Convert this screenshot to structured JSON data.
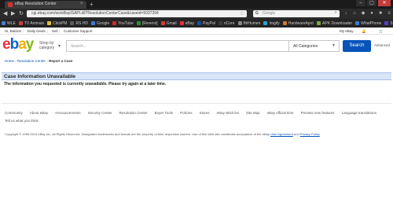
{
  "browser": {
    "tab_title": "eBay Resolution Center",
    "close_glyph": "×",
    "new_tab_glyph": "+",
    "window_controls": [
      "–",
      "▢",
      "✕"
    ],
    "url": "cgi.ebay.com/ws/eBayISAPI.dll?ResolutionCenterCase&caseid=5037394",
    "search_engine_glyph": "G",
    "search_placeholder": "Google",
    "bookmarks": [
      {
        "label": "WLE",
        "color": "#4a7bd1"
      },
      {
        "label": "TV Animaix",
        "color": "#d13b3b"
      },
      {
        "label": "ClickPM",
        "color": "#e0c23a"
      },
      {
        "label": "RS HD",
        "color": "#5a5a5a"
      },
      {
        "label": "Google",
        "color": "#3b7ad8"
      },
      {
        "label": "YouTube",
        "color": "#d12a2a"
      },
      {
        "label": "[Reversi]",
        "color": "#2e8b3e"
      },
      {
        "label": "Gmail",
        "color": "#d33a2c"
      },
      {
        "label": "eBay",
        "color": "#e53238"
      },
      {
        "label": "PayPal",
        "color": "#1b4f9c"
      },
      {
        "label": "nCore",
        "color": "#3a3a3a"
      },
      {
        "label": "BitHumen",
        "color": "#888"
      },
      {
        "label": "Imgify",
        "color": "#2aa3d1"
      },
      {
        "label": "HardwareApró",
        "color": "#d17a2a"
      },
      {
        "label": "APK Downloader",
        "color": "#7aa83a"
      },
      {
        "label": "WhatPhone",
        "color": "#3a7ad1"
      },
      {
        "label": "SULI",
        "color": "#5a3ad1"
      }
    ]
  },
  "ebay": {
    "greeting": "Hi, Balázs!",
    "top_links": [
      "Daily Deals",
      "Sell",
      "Customer Support"
    ],
    "my_ebay": "My eBay",
    "shop_by_category": "Shop by category",
    "search_placeholder": "Search...",
    "category_selected": "All Categories",
    "search_button": "Search",
    "advanced": "Advanced",
    "breadcrumb": [
      "Home",
      "Resolution Center",
      "Report a Case"
    ],
    "case_title": "Case Information Unavailable",
    "case_message": "The information you requested is currently unavailable. Please try again at a later time.",
    "footer_links": [
      "Community",
      "About eBay",
      "Announcements",
      "Security Center",
      "Resolution Center",
      "Buyer Tools",
      "Policies",
      "Stores",
      "eBay Wish list",
      "Site Map",
      "eBay official time",
      "Preview new features",
      "Language translations"
    ],
    "tell_us": "Tell us what you think",
    "copyright": "Copyright © 1995-2014 eBay Inc. All Rights Reserved. Designated trademarks and brands are the property of their respective owners. Use of this Web site constitutes acceptance of the eBay",
    "user_agreement": "User Agreement",
    "and": "and",
    "privacy_policy": "Privacy Policy"
  }
}
